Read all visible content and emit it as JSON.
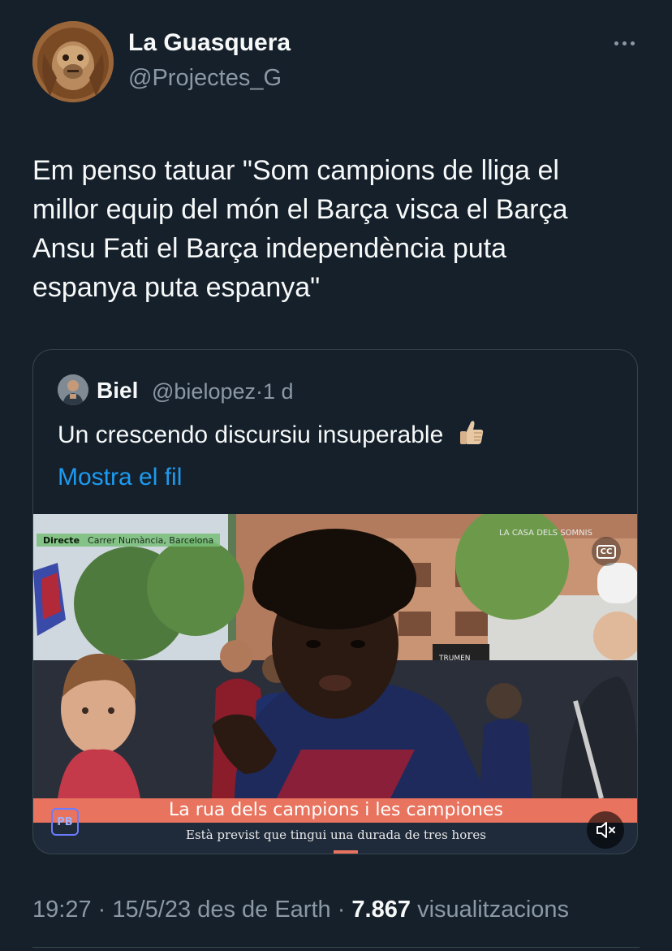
{
  "tweet": {
    "author_name": "La Guasquera",
    "author_handle": "@Projectes_G",
    "text": "Em penso tatuar \"Som campions de lliga el\nmillor equip del món el Barça visca el Barça\nAnsu Fati el Barça independència puta\nespanya puta espanya\"",
    "time": "19:27",
    "date": "15/5/23",
    "source": "des de Earth",
    "views_count": "7.867",
    "views_label": "visualitzacions",
    "separator": " · "
  },
  "quoted_tweet": {
    "author_name": "Biel",
    "author_handle": "@bielopez",
    "age": "1 d",
    "meta_separator": "·",
    "text": "Un crescendo discursiu insuperable",
    "emoji": "thumbs-up",
    "show_thread_label": "Mostra el fil"
  },
  "video": {
    "live_label": "Directe",
    "location": "Carrer Numància, Barcelona",
    "channel_tag": "LA CASA DELS SOMNIS",
    "shop_sign": "TRUMEN",
    "title": "La rua dels campions i les campiones",
    "subtitle": "Està previst que tingui una durada de tres hores",
    "logo_text": "PB",
    "cc_label": "CC"
  },
  "colors": {
    "background": "#15202b",
    "primary_text": "#f7f9f9",
    "secondary_text": "#8b98a5",
    "link": "#1d9bf0",
    "border": "#38444d",
    "lower_third_accent": "#e8735e"
  },
  "icons": {
    "more": "more-horizontal-icon",
    "closed_captions": "cc-icon",
    "mute": "volume-muted-icon"
  }
}
